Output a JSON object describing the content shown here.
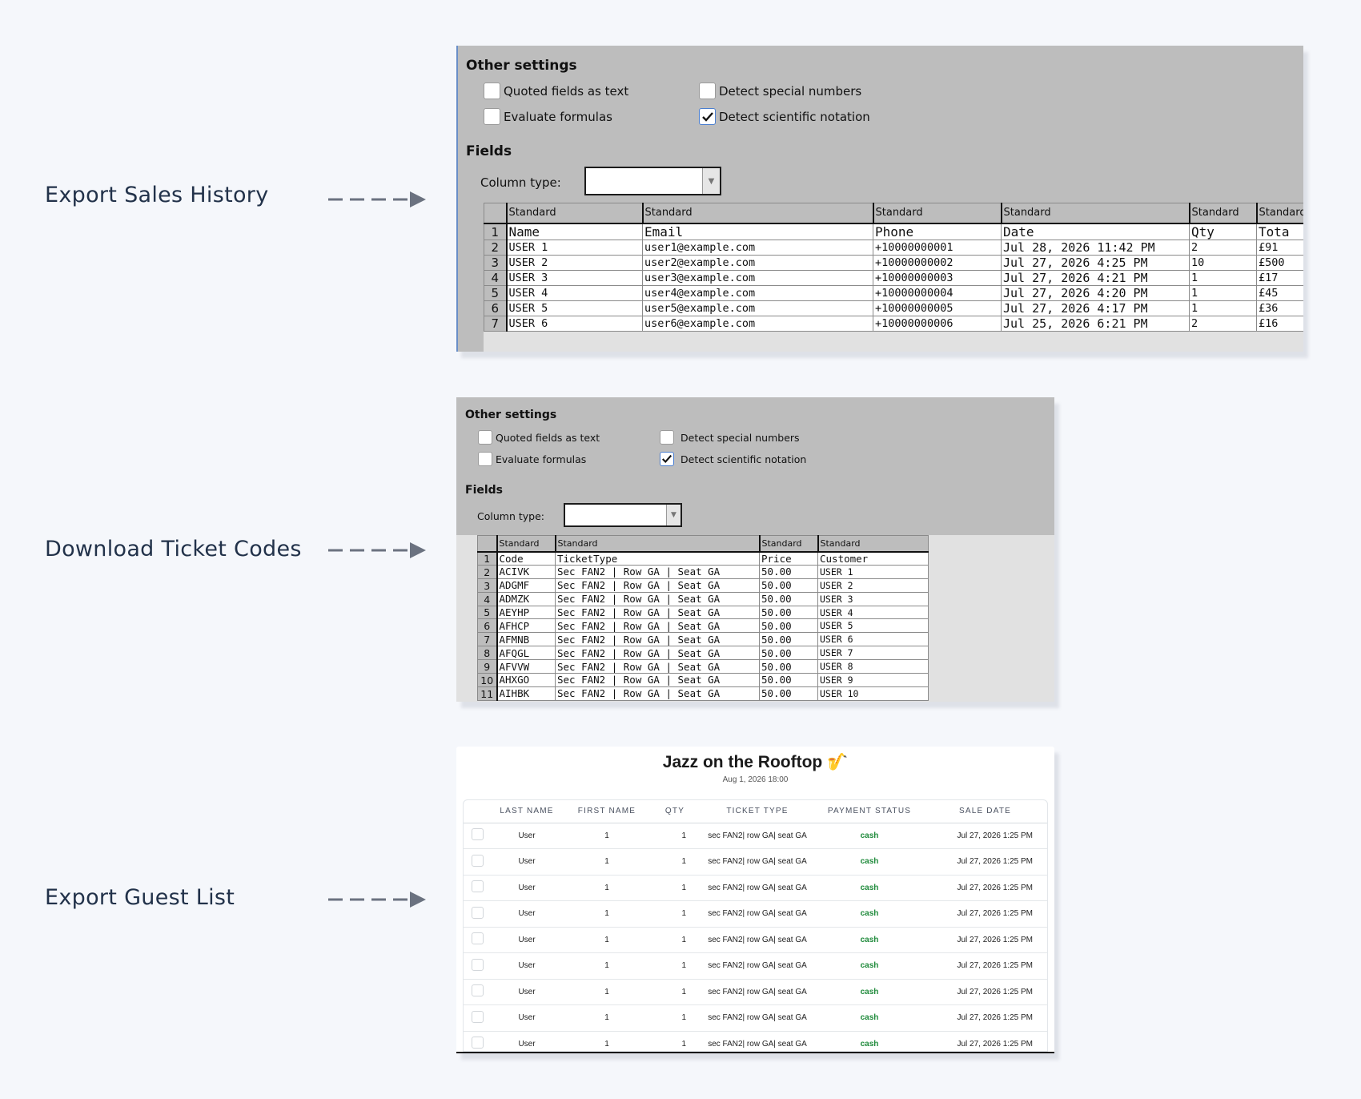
{
  "labels": [
    "Export Sales History",
    "Download Ticket Codes",
    "Export Guest List"
  ],
  "import_dialog": {
    "other_settings": "Other settings",
    "quoted_fields": "Quoted fields as text",
    "evaluate_formulas": "Evaluate formulas",
    "detect_special": "Detect special numbers",
    "detect_scientific": "Detect scientific notation",
    "fields": "Fields",
    "column_type": "Column type:"
  },
  "sales": {
    "col_type_label": "Standard",
    "header_cols": 6,
    "rows": [
      [
        "Name",
        "Email",
        "Phone",
        "Date",
        "Qty",
        "Tota"
      ],
      [
        "USER 1",
        "user1@example.com",
        "+10000000001",
        "Jul 28, 2026 11:42 PM",
        "2",
        "£91"
      ],
      [
        "USER 2",
        "user2@example.com",
        "+10000000002",
        "Jul 27, 2026 4:25 PM",
        "10",
        "£500"
      ],
      [
        "USER 3",
        "user3@example.com",
        "+10000000003",
        "Jul 27, 2026 4:21 PM",
        "1",
        "£17"
      ],
      [
        "USER 4",
        "user4@example.com",
        "+10000000004",
        "Jul 27, 2026 4:20 PM",
        "1",
        "£45"
      ],
      [
        "USER 5",
        "user5@example.com",
        "+10000000005",
        "Jul 27, 2026 4:17 PM",
        "1",
        "£36"
      ],
      [
        "USER 6",
        "user6@example.com",
        "+10000000006",
        "Jul 25, 2026 6:21 PM",
        "2",
        "£16"
      ]
    ]
  },
  "codes": {
    "col_type_label": "Standard",
    "rows": [
      [
        "Code",
        "TicketType",
        "Price",
        "Customer"
      ],
      [
        "ACIVK",
        "Sec FAN2 | Row GA | Seat GA",
        "50.00",
        "USER 1"
      ],
      [
        "ADGMF",
        "Sec FAN2 | Row GA | Seat GA",
        "50.00",
        "USER 2"
      ],
      [
        "ADMZK",
        "Sec FAN2 | Row GA | Seat GA",
        "50.00",
        "USER 3"
      ],
      [
        "AEYHP",
        "Sec FAN2 | Row GA | Seat GA",
        "50.00",
        "USER 4"
      ],
      [
        "AFHCP",
        "Sec FAN2 | Row GA | Seat GA",
        "50.00",
        "USER 5"
      ],
      [
        "AFMNB",
        "Sec FAN2 | Row GA | Seat GA",
        "50.00",
        "USER 6"
      ],
      [
        "AFQGL",
        "Sec FAN2 | Row GA | Seat GA",
        "50.00",
        "USER 7"
      ],
      [
        "AFVVW",
        "Sec FAN2 | Row GA | Seat GA",
        "50.00",
        "USER 8"
      ],
      [
        "AHXGO",
        "Sec FAN2 | Row GA | Seat GA",
        "50.00",
        "USER 9"
      ],
      [
        "AIHBK",
        "Sec FAN2 | Row GA | Seat GA",
        "50.00",
        "USER 10"
      ]
    ]
  },
  "guest": {
    "title": "Jazz on the Rooftop 🎷",
    "subtitle": "Aug 1, 2026 18:00",
    "columns": [
      "LAST NAME",
      "FIRST NAME",
      "QTY",
      "TICKET TYPE",
      "PAYMENT STATUS",
      "SALE DATE"
    ],
    "rows": [
      [
        "User",
        "1",
        "1",
        "sec FAN2| row GA| seat GA",
        "cash",
        "Jul 27, 2026 1:25 PM"
      ],
      [
        "User",
        "1",
        "1",
        "sec FAN2| row GA| seat GA",
        "cash",
        "Jul 27, 2026 1:25 PM"
      ],
      [
        "User",
        "1",
        "1",
        "sec FAN2| row GA| seat GA",
        "cash",
        "Jul 27, 2026 1:25 PM"
      ],
      [
        "User",
        "1",
        "1",
        "sec FAN2| row GA| seat GA",
        "cash",
        "Jul 27, 2026 1:25 PM"
      ],
      [
        "User",
        "1",
        "1",
        "sec FAN2| row GA| seat GA",
        "cash",
        "Jul 27, 2026 1:25 PM"
      ],
      [
        "User",
        "1",
        "1",
        "sec FAN2| row GA| seat GA",
        "cash",
        "Jul 27, 2026 1:25 PM"
      ],
      [
        "User",
        "1",
        "1",
        "sec FAN2| row GA| seat GA",
        "cash",
        "Jul 27, 2026 1:25 PM"
      ],
      [
        "User",
        "1",
        "1",
        "sec FAN2| row GA| seat GA",
        "cash",
        "Jul 27, 2026 1:25 PM"
      ],
      [
        "User",
        "1",
        "1",
        "sec FAN2| row GA| seat GA",
        "cash",
        "Jul 27, 2026 1:25 PM"
      ]
    ]
  },
  "colors": {
    "page_bg": "#f5f7fb",
    "dialog_bg": "#bdbdbd",
    "accent": "#4a7ed0",
    "status_green": "#1e8a3a",
    "label_text": "#22324a"
  }
}
